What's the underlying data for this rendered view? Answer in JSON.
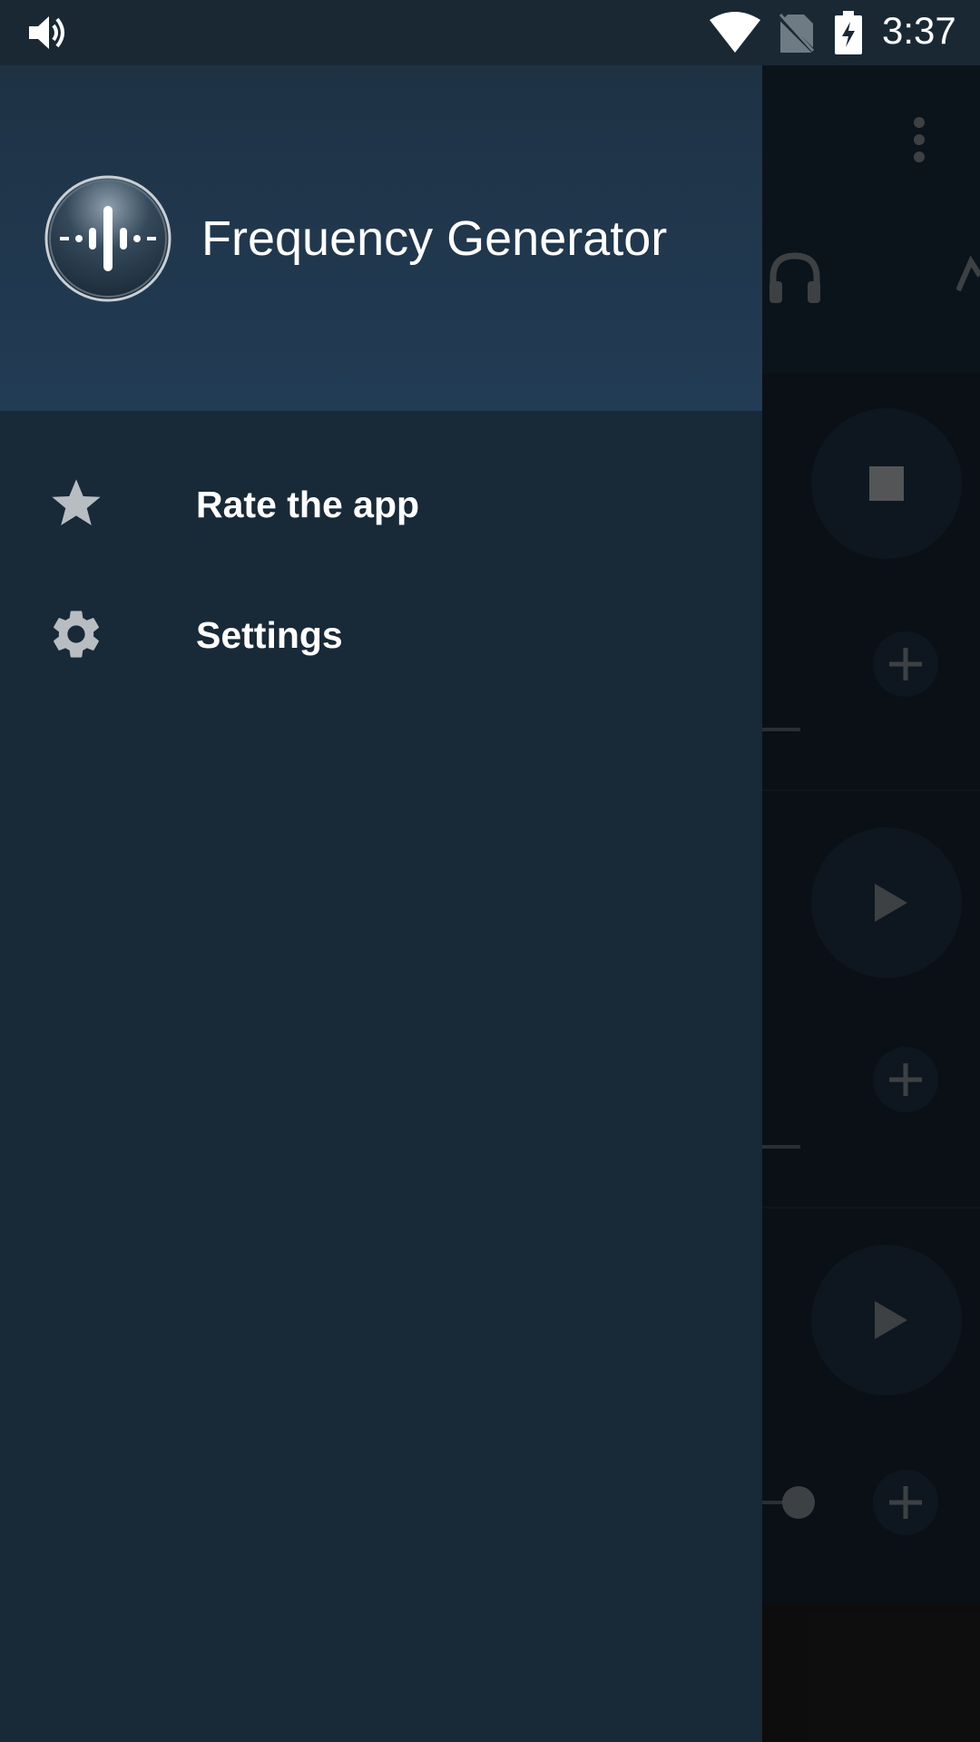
{
  "status_bar": {
    "time": "3:37",
    "icons": [
      "volume-icon",
      "wifi-icon",
      "no-sim-icon",
      "battery-charging-icon"
    ]
  },
  "drawer": {
    "header": {
      "app_title": "Frequency Generator",
      "logo_icon": "waveform-logo-icon"
    },
    "items": [
      {
        "label": "Rate the app",
        "icon": "star-icon"
      },
      {
        "label": "Settings",
        "icon": "gear-icon"
      }
    ]
  },
  "background_app": {
    "icons": [
      "overflow-menu-icon",
      "headphones-icon",
      "stop-icon",
      "play-icon",
      "play-icon",
      "plus-icon",
      "plus-icon",
      "plus-icon"
    ]
  },
  "colors": {
    "status_bar": "#1a2834",
    "drawer_bg": "#182937",
    "header_top": "#1e3244",
    "header_bottom": "#223c55",
    "text": "#ffffff",
    "icon_gray": "#b8bdc2"
  }
}
